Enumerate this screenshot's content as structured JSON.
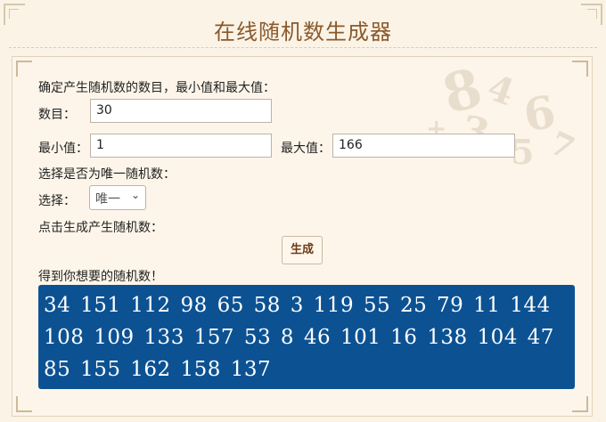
{
  "header": {
    "title": "在线随机数生成器"
  },
  "form": {
    "intro_label": "确定产生随机数的数目，最小值和最大值：",
    "count_label": "数目：",
    "count_value": "30",
    "min_label": "最小值：",
    "min_value": "1",
    "max_label": "最大值：",
    "max_value": "166",
    "unique_question": "选择是否为唯一随机数：",
    "select_label": "选择：",
    "select_value": "唯一",
    "generate_hint": "点击生成产生随机数：",
    "generate_button": "生成",
    "result_label": "得到你想要的随机数！"
  },
  "results": {
    "numbers": "34 151 112 98 65 58 3 119 55 25 79 11 144 108 109 133 157 53 8 46 101 16 138 104 47 85 155 162 158 137"
  },
  "theme": {
    "accent": "#8a5a2d",
    "result_bg": "#0c5293",
    "page_bg": "#fbf3e6"
  }
}
